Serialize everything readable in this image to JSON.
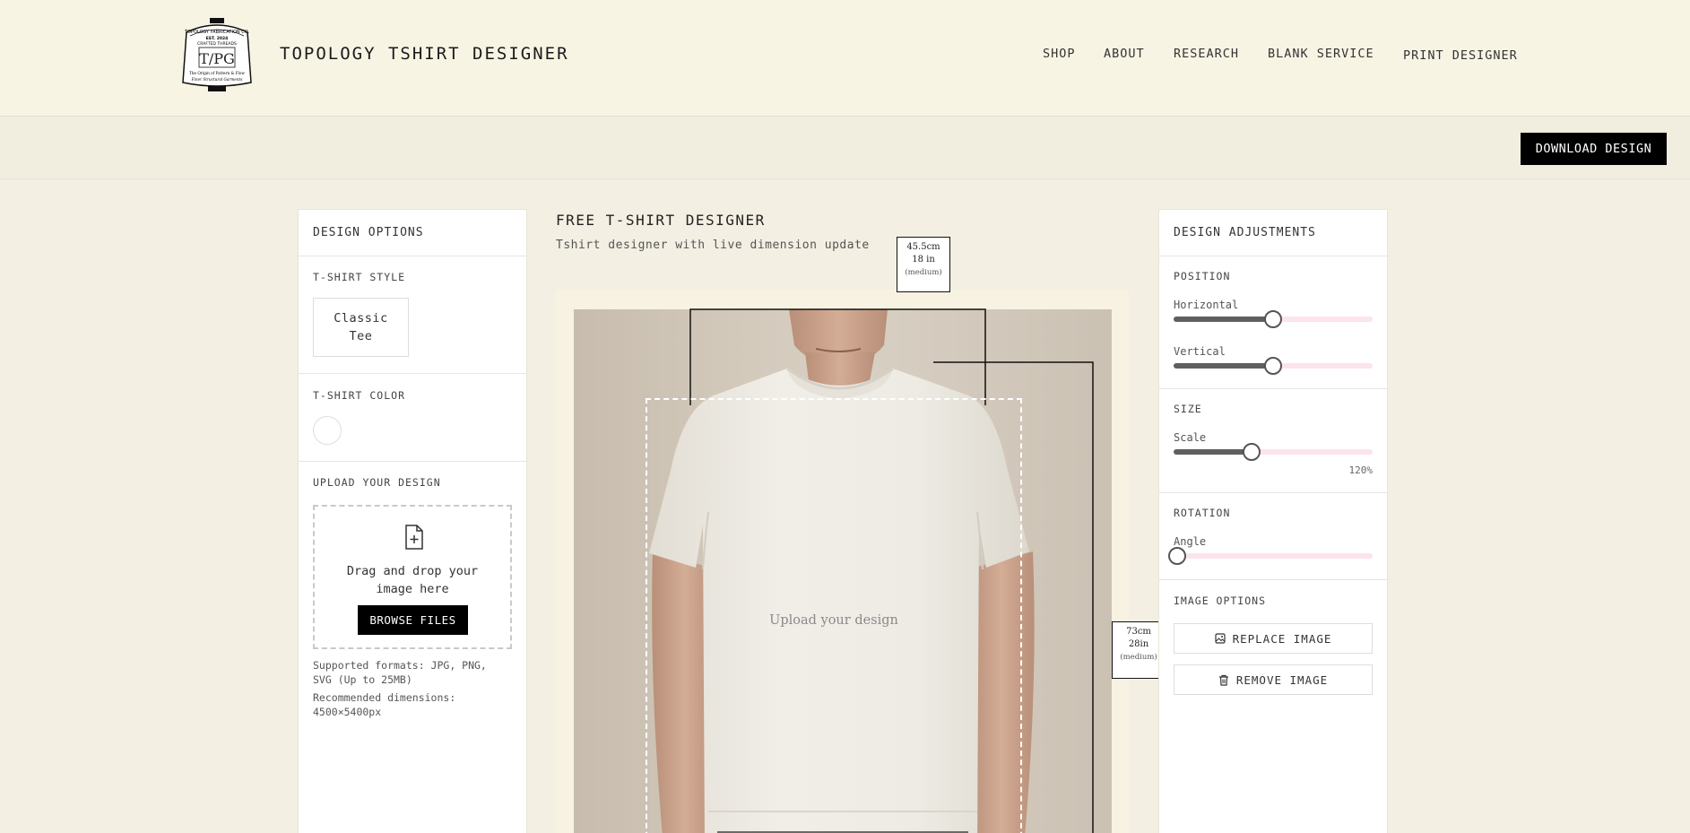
{
  "header": {
    "brand": "TOPOLOGY TSHIRT DESIGNER",
    "logo_text": [
      "TOPOLOGY FABRICATION CO.",
      "EST. 2024",
      "CRAFTED THREADS",
      "T/PG",
      "The Origin of Pattern & Flow",
      "Finer Structural Garments"
    ],
    "nav": [
      "SHOP",
      "ABOUT",
      "RESEARCH",
      "BLANK SERVICE",
      "PRINT DESIGNER"
    ]
  },
  "toolbar": {
    "download_label": "DOWNLOAD DESIGN"
  },
  "left_panel": {
    "title": "DESIGN OPTIONS",
    "style_title": "T-SHIRT STYLE",
    "style_option_line1": "Classic",
    "style_option_line2": "Tee",
    "color_title": "T-SHIRT COLOR",
    "selected_color": "#ffffff",
    "upload_title": "UPLOAD YOUR DESIGN",
    "drop_line1": "Drag and drop your",
    "drop_line2": "image here",
    "browse_label": "BROWSE FILES",
    "formats_line1": "Supported formats: JPG, PNG,",
    "formats_line2": "SVG (Up to 25MB)",
    "dims_line1": "Recommended dimensions:",
    "dims_line2": "4500×5400px"
  },
  "center": {
    "title": "FREE T-SHIRT DESIGNER",
    "subtitle": "Tshirt designer with live dimension update",
    "width_dim": {
      "cm": "45.5cm",
      "in": "18 in",
      "size": "(medium)"
    },
    "height_dim": {
      "cm": "73cm",
      "in": "28in",
      "size": "(medium)"
    },
    "upload_placeholder": "Upload your design"
  },
  "right_panel": {
    "title": "DESIGN ADJUSTMENTS",
    "position_title": "POSITION",
    "horizontal_label": "Horizontal",
    "horizontal_value": 0.5,
    "vertical_label": "Vertical",
    "vertical_value": 0.5,
    "size_title": "SIZE",
    "scale_label": "Scale",
    "scale_value": 0.39,
    "scale_text": "120%",
    "rotation_title": "ROTATION",
    "angle_label": "Angle",
    "angle_value": 0,
    "image_options_title": "IMAGE OPTIONS",
    "replace_label": "REPLACE IMAGE",
    "remove_label": "REMOVE IMAGE"
  },
  "colors": {
    "accent_track": "#fce4ea",
    "fill": "#5f5f5f",
    "background": "#f3efe2"
  }
}
